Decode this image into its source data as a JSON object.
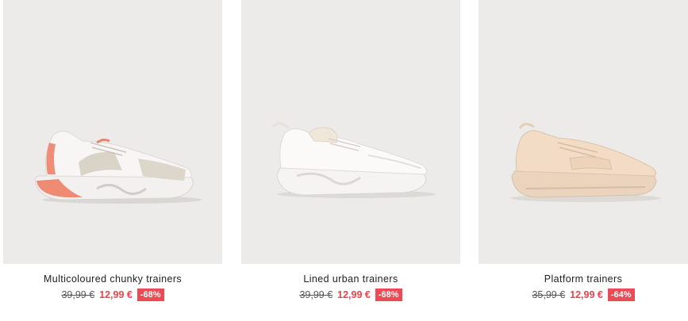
{
  "products": [
    {
      "image_icon": "multicoloured-chunky-trainer-image",
      "name": "Multicoloured chunky trainers",
      "old_price": "39,99 €",
      "new_price": "12,99 €",
      "discount": "-68%"
    },
    {
      "image_icon": "lined-urban-trainer-image",
      "name": "Lined urban trainers",
      "old_price": "39,99 €",
      "new_price": "12,99 €",
      "discount": "-68%"
    },
    {
      "image_icon": "platform-trainer-image",
      "name": "Platform trainers",
      "old_price": "35,99 €",
      "new_price": "12,99 €",
      "discount": "-64%"
    }
  ],
  "colors": {
    "image_bg": "#ecebea",
    "sale_price": "#e6464b",
    "badge_bg": "#ec4a55"
  }
}
